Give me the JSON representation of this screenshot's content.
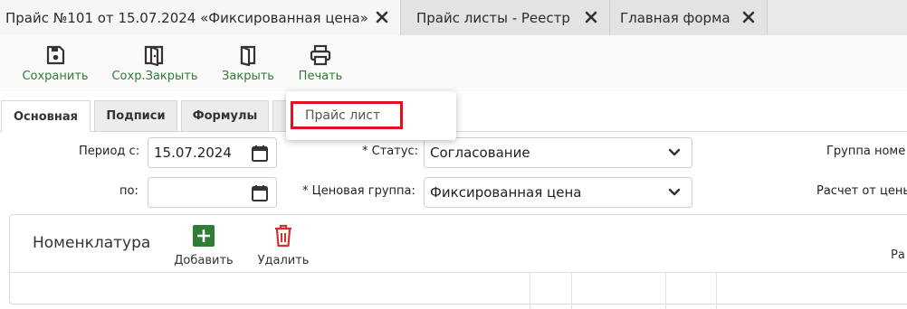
{
  "doc_tabs": [
    {
      "label": "Прайс №101 от 15.07.2024 «Фиксированная цена»",
      "active": true
    },
    {
      "label": "Прайс листы - Реестр",
      "active": false
    },
    {
      "label": "Главная форма",
      "active": false
    }
  ],
  "toolbar": {
    "save_label": "Сохранить",
    "save_close_label": "Сохр.Закрыть",
    "close_label": "Закрыть",
    "print_label": "Печать"
  },
  "inner_tabs": [
    "Основная",
    "Подписи",
    "Формулы"
  ],
  "print_menu": {
    "items": [
      "Прайс лист"
    ]
  },
  "form": {
    "period_from_label": "Период с:",
    "period_from_value": "15.07.2024",
    "period_to_label": "по:",
    "period_to_value": "",
    "status_label": "* Статус:",
    "status_value": "Согласование",
    "price_group_label": "* Ценовая группа:",
    "price_group_value": "Фиксированная цена",
    "nomenclature_group_label": "Группа номе",
    "calc_from_label": "Расчет от цены"
  },
  "nomenclature": {
    "title": "Номенклатура",
    "add_label": "Добавить",
    "delete_label": "Удалить",
    "right_header_fragment": "Ра"
  },
  "colors": {
    "accent_green": "#2e7d32",
    "delete_red": "#d32f2f",
    "highlight_red": "#e0121f"
  }
}
